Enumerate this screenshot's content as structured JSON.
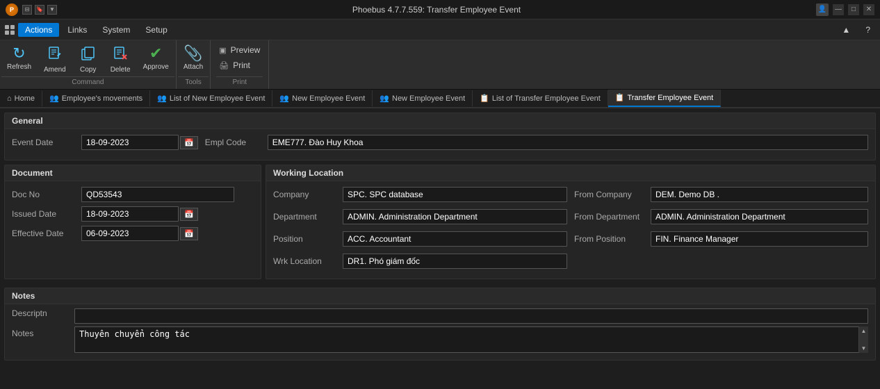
{
  "titleBar": {
    "title": "Phoebus 4.7.7.559: Transfer Employee Event",
    "logo": "P",
    "controls": [
      "—",
      "□",
      "✕"
    ]
  },
  "menuBar": {
    "gridIcon": true,
    "items": [
      {
        "label": "Actions",
        "active": true
      },
      {
        "label": "Links",
        "active": false
      },
      {
        "label": "System",
        "active": false
      },
      {
        "label": "Setup",
        "active": false
      }
    ],
    "collapseLabel": "▲",
    "helpLabel": "?"
  },
  "toolbar": {
    "command": {
      "sectionLabel": "Command",
      "buttons": [
        {
          "id": "refresh",
          "icon": "↻",
          "label": "Refresh",
          "disabled": false
        },
        {
          "id": "amend",
          "icon": "✎",
          "label": "Amend",
          "disabled": false
        },
        {
          "id": "copy",
          "icon": "⧉",
          "label": "Copy",
          "disabled": false
        },
        {
          "id": "delete",
          "icon": "✖",
          "label": "Delete",
          "disabled": false,
          "color": "red"
        },
        {
          "id": "approve",
          "icon": "✔",
          "label": "Approve",
          "disabled": false,
          "color": "teal"
        }
      ]
    },
    "tools": {
      "sectionLabel": "Tools",
      "buttons": [
        {
          "id": "attach",
          "icon": "📎",
          "label": "Attach",
          "disabled": false
        }
      ]
    },
    "print": {
      "sectionLabel": "Print",
      "items": [
        {
          "id": "preview",
          "icon": "▣",
          "label": "Preview"
        },
        {
          "id": "print",
          "icon": "🖨",
          "label": "Print"
        }
      ]
    }
  },
  "breadcrumbs": [
    {
      "id": "home",
      "icon": "⌂",
      "label": "Home",
      "active": false
    },
    {
      "id": "emp-movements",
      "icon": "👥",
      "label": "Employee's movements",
      "active": false
    },
    {
      "id": "list-new-emp",
      "icon": "👥",
      "label": "List of New Employee Event",
      "active": false
    },
    {
      "id": "new-emp-event1",
      "icon": "👥",
      "label": "New Employee Event",
      "active": false
    },
    {
      "id": "new-emp-event2",
      "icon": "👥",
      "label": "New Employee Event",
      "active": false
    },
    {
      "id": "list-transfer",
      "icon": "📋",
      "label": "List of Transfer Employee Event",
      "active": false
    },
    {
      "id": "transfer-event",
      "icon": "📋",
      "label": "Transfer Employee Event",
      "active": true
    }
  ],
  "general": {
    "sectionLabel": "General",
    "eventDateLabel": "Event Date",
    "eventDateValue": "18-09-2023",
    "emplCodeLabel": "Empl Code",
    "emplCodeValue": "EME777.  Đào Huy Khoa"
  },
  "document": {
    "sectionLabel": "Document",
    "docNoLabel": "Doc No",
    "docNoValue": "QD53543",
    "issuedDateLabel": "Issued Date",
    "issuedDateValue": "18-09-2023",
    "effectiveDateLabel": "Effective Date",
    "effectiveDateValue": "06-09-2023"
  },
  "workingLocation": {
    "sectionLabel": "Working Location",
    "companyLabel": "Company",
    "companyValue": "SPC. SPC database",
    "fromCompanyLabel": "From Company",
    "fromCompanyValue": "DEM. Demo DB .",
    "departmentLabel": "Department",
    "departmentValue": "ADMIN. Administration Department",
    "fromDepartmentLabel": "From Department",
    "fromDepartmentValue": "ADMIN. Administration Department",
    "positionLabel": "Position",
    "positionValue": "ACC. Accountant",
    "fromPositionLabel": "From Position",
    "fromPositionValue": "FIN. Finance Manager",
    "wrkLocationLabel": "Wrk Location",
    "wrkLocationValue": "DR1. Phó giám đốc"
  },
  "notes": {
    "sectionLabel": "Notes",
    "descriptnLabel": "Descriptn",
    "descriptnValue": "",
    "notesLabel": "Notes",
    "notesValue": "Thuyên chuyển công tác"
  }
}
